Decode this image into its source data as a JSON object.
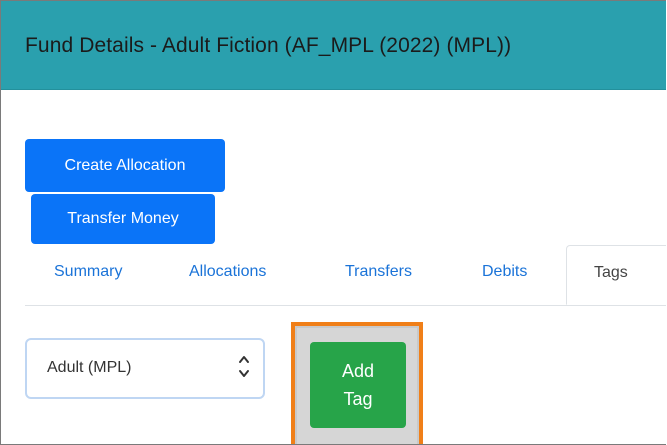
{
  "header": {
    "title": "Fund Details - Adult Fiction (AF_MPL (2022) (MPL))"
  },
  "actions": {
    "create_allocation_label": "Create Allocation",
    "transfer_money_label": "Transfer Money"
  },
  "tabs": [
    {
      "label": "Summary",
      "active": false
    },
    {
      "label": "Allocations",
      "active": false
    },
    {
      "label": "Transfers",
      "active": false
    },
    {
      "label": "Debits",
      "active": false
    },
    {
      "label": "Tags",
      "active": true
    }
  ],
  "tag_form": {
    "select_value": "Adult (MPL)",
    "add_button_line1": "Add",
    "add_button_line2": "Tag"
  },
  "colors": {
    "header_bg": "#2aa0ae",
    "primary_button": "#0a74f8",
    "success_button": "#27a449",
    "highlight_border": "#f07f18",
    "tab_link": "#1a73d8"
  },
  "icons": {
    "select_arrows": "up-down-chevron-icon"
  }
}
